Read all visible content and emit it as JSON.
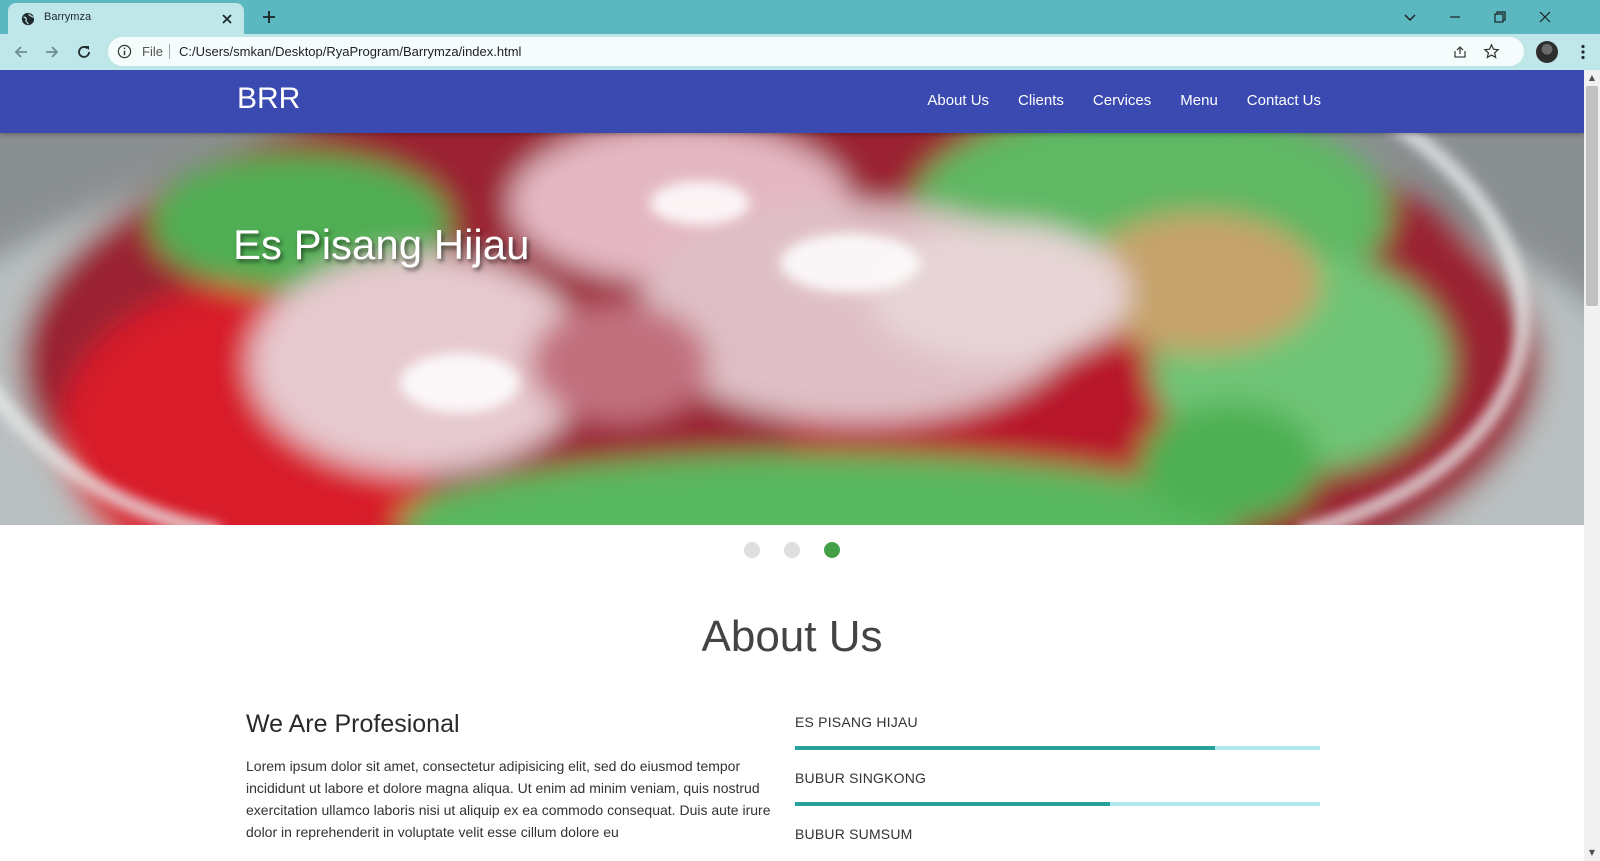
{
  "browser": {
    "tab_title": "Barrymza",
    "address": {
      "scheme_label": "File",
      "url": "C:/Users/smkan/Desktop/RyaProgram/Barrymza/index.html"
    },
    "tabbar_color": "#5bb8c1",
    "toolbar_color": "#bfe7ea"
  },
  "site": {
    "brand": "BRR",
    "nav_color": "#3a4ab0",
    "nav_links": [
      {
        "label": "About Us"
      },
      {
        "label": "Clients"
      },
      {
        "label": "Cervices"
      },
      {
        "label": "Menu"
      },
      {
        "label": "Contact Us"
      }
    ]
  },
  "slider": {
    "caption": "Es Pisang Hijau",
    "slide_count": 3,
    "active_index": 2,
    "active_color": "#43a047"
  },
  "about": {
    "title": "About Us",
    "subtitle": "We Are Profesional",
    "paragraph": "Lorem ipsum dolor sit amet, consectetur adipisicing elit, sed do eiusmod tempor incididunt ut labore et dolore magna aliqua. Ut enim ad minim veniam, quis nostrud exercitation ullamco laboris nisi ut aliquip ex ea commodo consequat. Duis aute irure dolor in reprehenderit in voluptate velit esse cillum dolore eu",
    "skills": [
      {
        "label": "Es Pisang Hijau",
        "value": 0.8
      },
      {
        "label": "Bubur Singkong",
        "value": 0.6
      },
      {
        "label": "Bubur Sumsum",
        "value": null
      }
    ],
    "skill_fill_color": "#26a19a",
    "skill_track_color": "#aee8ea"
  }
}
